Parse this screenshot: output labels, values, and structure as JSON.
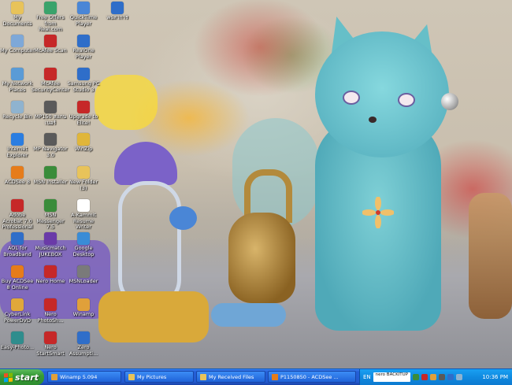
{
  "desktop": {
    "icons": [
      {
        "label": "My Documents",
        "icon": "folder-documents-icon",
        "color": "#e8c35a"
      },
      {
        "label": "Free Offers from Real.com",
        "icon": "real-offers-icon",
        "color": "#3aa36b"
      },
      {
        "label": "QuickTime Player",
        "icon": "quicktime-icon",
        "color": "#4a86d6"
      },
      {
        "label": "wsสาการ",
        "icon": "shortcut-icon",
        "color": "#2f6ec9"
      },
      {
        "label": "My Computer",
        "icon": "computer-icon",
        "color": "#7ea8d8"
      },
      {
        "label": "McAfee Scan",
        "icon": "mcafee-scan-icon",
        "color": "#c62828"
      },
      {
        "label": "RealOne Player",
        "icon": "realone-icon",
        "color": "#2f6ec9"
      },
      {
        "label": "My Network Places",
        "icon": "network-icon",
        "color": "#5a9bd6"
      },
      {
        "label": "McAfee SecurityCenter",
        "icon": "mcafee-securitycenter-icon",
        "color": "#c62828"
      },
      {
        "label": "Samsung PC Studio 3",
        "icon": "samsung-icon",
        "color": "#2f6ec9"
      },
      {
        "label": "Recycle Bin",
        "icon": "recycle-bin-icon",
        "color": "#8fb3cf"
      },
      {
        "label": "MP150 สแกนเนอร์",
        "icon": "scanner-icon",
        "color": "#5a5a5a"
      },
      {
        "label": "Upgrade to Elite!",
        "icon": "upgrade-icon",
        "color": "#c62828"
      },
      {
        "label": "Internet Explorer",
        "icon": "internet-explorer-icon",
        "color": "#2a7de1"
      },
      {
        "label": "MP Navigator 3.0",
        "icon": "mp-navigator-icon",
        "color": "#5a5a5a"
      },
      {
        "label": "WinZip",
        "icon": "winzip-icon",
        "color": "#e0b63a"
      },
      {
        "label": "ACDSee 8",
        "icon": "acdsee-icon",
        "color": "#e67c1a"
      },
      {
        "label": "MSN Installer",
        "icon": "msn-installer-icon",
        "color": "#3a8c3a"
      },
      {
        "label": "New Folder (3)",
        "icon": "folder-icon",
        "color": "#e8c35a"
      },
      {
        "label": "Adobe Acrobat 7.0 Professional",
        "icon": "acrobat-icon",
        "color": "#c62828"
      },
      {
        "label": "MSN Messenger 7.5",
        "icon": "msn-messenger-icon",
        "color": "#3a8c3a"
      },
      {
        "label": "A-Kammit Resume Writer",
        "icon": "document-icon",
        "color": "#ffffff"
      },
      {
        "label": "AOL for Broadband",
        "icon": "aol-icon",
        "color": "#2f6ec9"
      },
      {
        "label": "Musicmatch JUKEBOX",
        "icon": "musicmatch-icon",
        "color": "#6a3aa8"
      },
      {
        "label": "Google Desktop",
        "icon": "google-desktop-icon",
        "color": "#3a8cd6"
      },
      {
        "label": "Buy ACDSee 8 Online",
        "icon": "acdsee-buy-icon",
        "color": "#e67c1a"
      },
      {
        "label": "Nero Home",
        "icon": "nero-home-icon",
        "color": "#c62828"
      },
      {
        "label": "MSNLoader",
        "icon": "msn-loader-icon",
        "color": "#7a7a7a"
      },
      {
        "label": "CyberLink PowerDVD",
        "icon": "powerdvd-icon",
        "color": "#e0a83a"
      },
      {
        "label": "Nero PhotoSh...",
        "icon": "nero-photoshow-icon",
        "color": "#c62828"
      },
      {
        "label": "Winamp",
        "icon": "winamp-icon",
        "color": "#e0a03a"
      },
      {
        "label": "Easy-Photo...",
        "icon": "easy-photo-icon",
        "color": "#2f8d8d"
      },
      {
        "label": "Nero StartSmart",
        "icon": "nero-startsmart-icon",
        "color": "#c62828"
      },
      {
        "label": "Zero Assumpti...",
        "icon": "zero-assumption-icon",
        "color": "#2f6ec9"
      }
    ]
  },
  "taskbar": {
    "start_label": "start",
    "tasks": [
      {
        "label": "Winamp 5.094",
        "icon": "winamp-task-icon",
        "color": "#e0a03a"
      },
      {
        "label": "My Pictures",
        "icon": "folder-task-icon",
        "color": "#e8c35a"
      },
      {
        "label": "My Received Files",
        "icon": "folder-task-icon",
        "color": "#e8c35a"
      },
      {
        "label": "P1150850 - ACDSee ...",
        "icon": "acdsee-task-icon",
        "color": "#e67c1a"
      }
    ],
    "tray": {
      "language": "EN",
      "nero_label": "nero BACKITUP",
      "clock": "10:36 PM"
    }
  }
}
